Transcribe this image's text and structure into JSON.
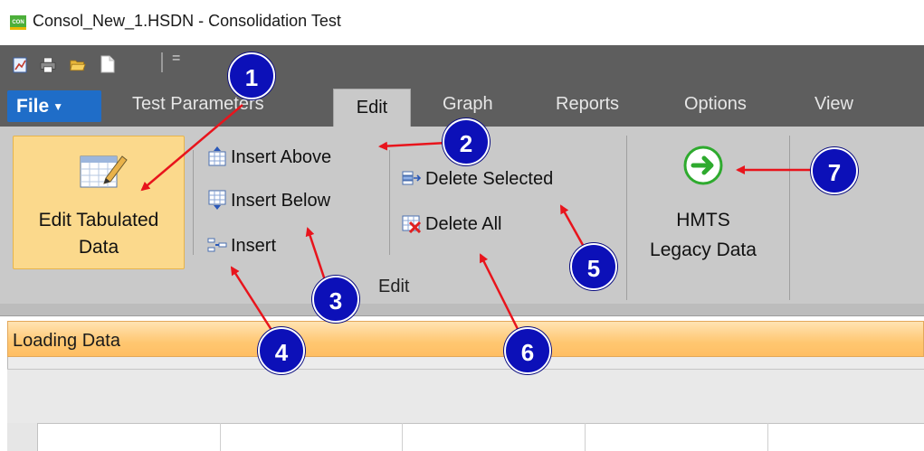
{
  "window": {
    "app_icon_text": "CON",
    "title": "Consol_New_1.HSDN - Consolidation Test"
  },
  "quick_access": {
    "icons": [
      "graph-icon",
      "print-icon",
      "open-folder-icon",
      "new-document-icon",
      "customize-toolbar-icon"
    ],
    "more_glyph": "="
  },
  "tabs": {
    "file": "File",
    "items": [
      "Test Parameters",
      "Edit",
      "Graph",
      "Reports",
      "Options",
      "View"
    ],
    "active": "Edit"
  },
  "ribbon": {
    "edit_tabulated": {
      "line1": "Edit Tabulated",
      "line2": "Data"
    },
    "insert_above": "Insert Above",
    "insert_below": "Insert Below",
    "insert": "Insert",
    "delete_selected": "Delete Selected",
    "delete_all": "Delete All",
    "hmts": {
      "line1": "HMTS",
      "line2": "Legacy Data"
    },
    "group_label": "Edit"
  },
  "status": {
    "loading_text": "Loading Data"
  },
  "callouts": [
    "1",
    "2",
    "3",
    "4",
    "5",
    "6",
    "7"
  ],
  "colors": {
    "ribbon_dark": "#5e5e5e",
    "ribbon_body": "#c9c9c9",
    "file_tab": "#1f6dc8",
    "highlight_button": "#fbd98c",
    "status_strip": "#ffc771",
    "callout_badge": "#0c10b8",
    "arrow": "#e8141c",
    "hmts_arrow": "#2eaa2e"
  }
}
